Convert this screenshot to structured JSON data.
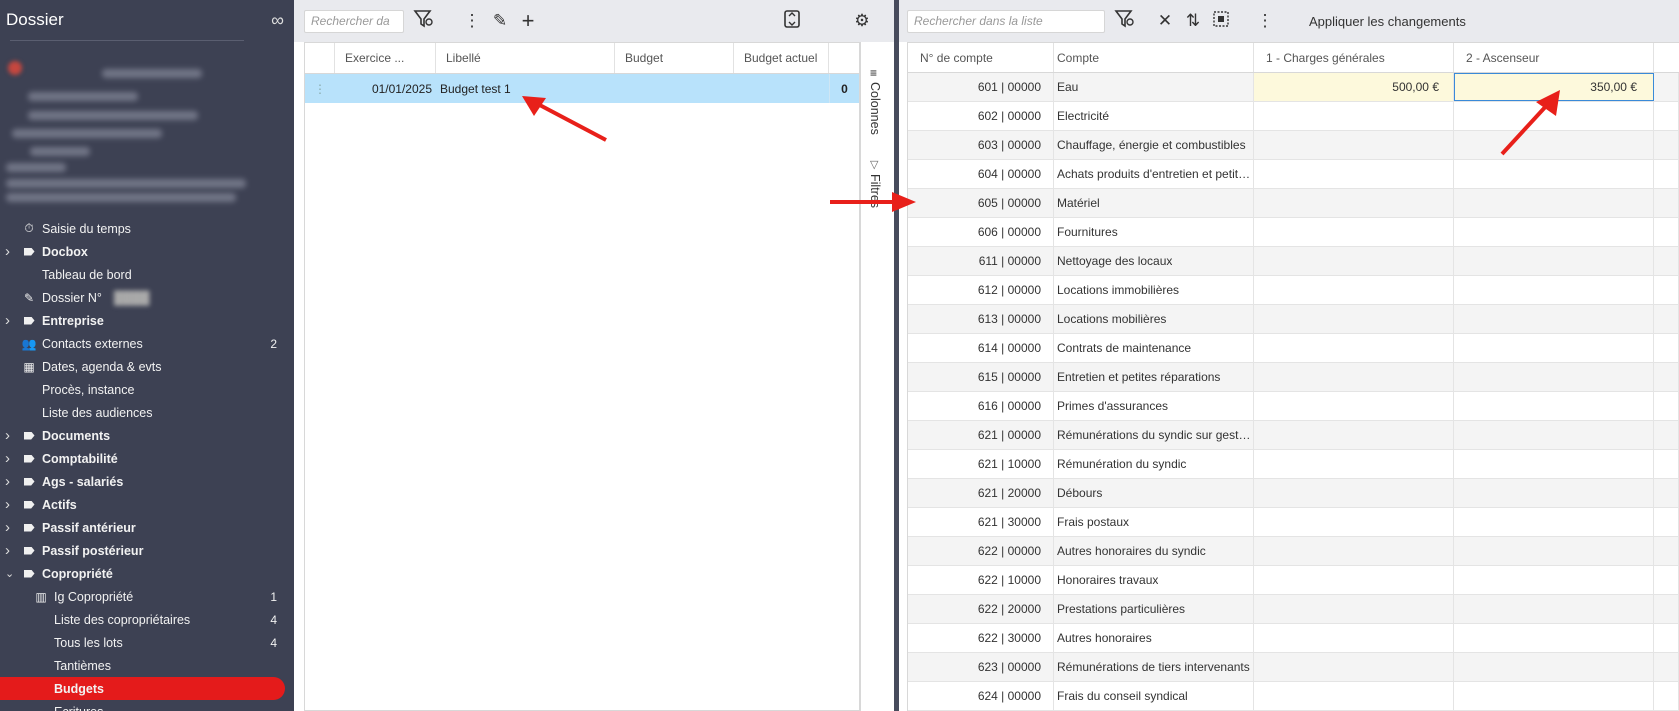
{
  "sidebar": {
    "title": "Dossier",
    "link_icon": "infinity-link-icon",
    "nav": [
      {
        "label": "Saisie du temps",
        "icon": "timer-icon",
        "level": 1,
        "bold": false,
        "chevron": false
      },
      {
        "label": "Docbox",
        "icon": "tag-icon",
        "level": 1,
        "bold": true,
        "chevron": true
      },
      {
        "label": "Tableau de bord",
        "icon": "",
        "level": 1,
        "bold": false,
        "chevron": false
      },
      {
        "label": "Dossier N°",
        "icon": "pencil-icon",
        "level": 1,
        "bold": false,
        "chevron": false,
        "blurred_suffix": true
      },
      {
        "label": "Entreprise",
        "icon": "tag-icon",
        "level": 1,
        "bold": true,
        "chevron": true
      },
      {
        "label": "Contacts externes",
        "icon": "people-icon",
        "level": 1,
        "bold": false,
        "chevron": false,
        "count": "2"
      },
      {
        "label": "Dates, agenda & evts",
        "icon": "calendar-icon",
        "level": 1,
        "bold": false,
        "chevron": false
      },
      {
        "label": "Procès, instance",
        "icon": "",
        "level": 1,
        "bold": false,
        "chevron": false
      },
      {
        "label": "Liste des audiences",
        "icon": "",
        "level": 1,
        "bold": false,
        "chevron": false
      },
      {
        "label": "Documents",
        "icon": "tag-icon",
        "level": 1,
        "bold": true,
        "chevron": true
      },
      {
        "label": "Comptabilité",
        "icon": "tag-icon",
        "level": 1,
        "bold": true,
        "chevron": true
      },
      {
        "label": "Ags - salariés",
        "icon": "tag-icon",
        "level": 1,
        "bold": true,
        "chevron": true
      },
      {
        "label": "Actifs",
        "icon": "tag-icon",
        "level": 1,
        "bold": true,
        "chevron": true
      },
      {
        "label": "Passif antérieur",
        "icon": "tag-icon",
        "level": 1,
        "bold": true,
        "chevron": true
      },
      {
        "label": "Passif postérieur",
        "icon": "tag-icon",
        "level": 1,
        "bold": true,
        "chevron": true
      },
      {
        "label": "Copropriété",
        "icon": "tag-icon",
        "level": 1,
        "bold": true,
        "chevron": true,
        "expanded": true
      },
      {
        "label": "Ig Copropriété",
        "icon": "chart-icon",
        "level": 2,
        "bold": false,
        "chevron": false,
        "count": "1"
      },
      {
        "label": "Liste des copropriétaires",
        "icon": "",
        "level": 2,
        "bold": false,
        "chevron": false,
        "count": "4"
      },
      {
        "label": "Tous les lots",
        "icon": "",
        "level": 2,
        "bold": false,
        "chevron": false,
        "count": "4"
      },
      {
        "label": "Tantièmes",
        "icon": "",
        "level": 2,
        "bold": false,
        "chevron": false
      },
      {
        "label": "Budgets",
        "icon": "",
        "level": 2,
        "bold": true,
        "chevron": false,
        "active": true
      },
      {
        "label": "Ecritures",
        "icon": "",
        "level": 2,
        "bold": false,
        "chevron": false
      }
    ]
  },
  "middle": {
    "search_placeholder": "Rechercher da",
    "columns": [
      "Exercice ...",
      "Libellé",
      "Budget",
      "Budget actuel"
    ],
    "rows": [
      {
        "exercice": "01/01/2025",
        "libelle": "Budget test 1",
        "budget": "",
        "budget_actuel": "",
        "count": "0"
      }
    ],
    "side_tabs": {
      "columns": "Colonnes",
      "filters": "Filtres"
    }
  },
  "right": {
    "search_placeholder": "Rechercher dans la liste",
    "apply_label": "Appliquer les changements",
    "columns": [
      "N° de compte",
      "Compte",
      "1 - Charges générales",
      "2 - Ascenseur"
    ],
    "rows": [
      {
        "num": "601 | 00000",
        "compte": "Eau",
        "v1": "500,00 €",
        "v2": "350,00 €"
      },
      {
        "num": "602 | 00000",
        "compte": "Electricité",
        "v1": "",
        "v2": ""
      },
      {
        "num": "603 | 00000",
        "compte": "Chauffage, énergie et combustibles",
        "v1": "",
        "v2": ""
      },
      {
        "num": "604 | 00000",
        "compte": "Achats produits d'entretien et petits équipements",
        "v1": "",
        "v2": ""
      },
      {
        "num": "605 | 00000",
        "compte": "Matériel",
        "v1": "",
        "v2": ""
      },
      {
        "num": "606 | 00000",
        "compte": "Fournitures",
        "v1": "",
        "v2": ""
      },
      {
        "num": "611 | 00000",
        "compte": "Nettoyage des locaux",
        "v1": "",
        "v2": ""
      },
      {
        "num": "612 | 00000",
        "compte": "Locations immobilières",
        "v1": "",
        "v2": ""
      },
      {
        "num": "613 | 00000",
        "compte": "Locations mobilières",
        "v1": "",
        "v2": ""
      },
      {
        "num": "614 | 00000",
        "compte": "Contrats de maintenance",
        "v1": "",
        "v2": ""
      },
      {
        "num": "615 | 00000",
        "compte": "Entretien et petites réparations",
        "v1": "",
        "v2": ""
      },
      {
        "num": "616 | 00000",
        "compte": "Primes d'assurances",
        "v1": "",
        "v2": ""
      },
      {
        "num": "621 | 00000",
        "compte": "Rémunérations du syndic sur gestion",
        "v1": "",
        "v2": ""
      },
      {
        "num": "621 | 10000",
        "compte": "Rémunération du syndic",
        "v1": "",
        "v2": ""
      },
      {
        "num": "621 | 20000",
        "compte": "Débours",
        "v1": "",
        "v2": ""
      },
      {
        "num": "621 | 30000",
        "compte": "Frais postaux",
        "v1": "",
        "v2": ""
      },
      {
        "num": "622 | 00000",
        "compte": "Autres honoraires du syndic",
        "v1": "",
        "v2": ""
      },
      {
        "num": "622 | 10000",
        "compte": "Honoraires travaux",
        "v1": "",
        "v2": ""
      },
      {
        "num": "622 | 20000",
        "compte": "Prestations particulières",
        "v1": "",
        "v2": ""
      },
      {
        "num": "622 | 30000",
        "compte": "Autres honoraires",
        "v1": "",
        "v2": ""
      },
      {
        "num": "623 | 00000",
        "compte": "Rémunérations de tiers intervenants",
        "v1": "",
        "v2": ""
      },
      {
        "num": "624 | 00000",
        "compte": "Frais du conseil syndical",
        "v1": "",
        "v2": ""
      }
    ]
  },
  "colors": {
    "sidebar_bg": "#3d4153",
    "active": "#e41b1b",
    "selected_row": "#b8e2fb",
    "edited_cell": "#fdf9dc",
    "arrow": "#e8201a"
  }
}
